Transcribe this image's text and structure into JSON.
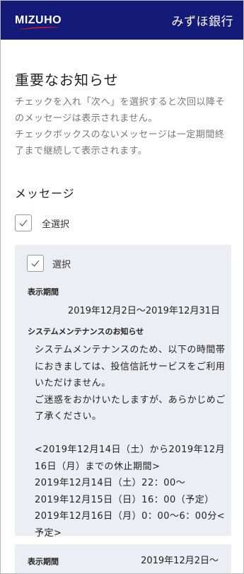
{
  "header": {
    "logo": "MIZUHO",
    "bank_name": "みずほ銀行"
  },
  "page": {
    "title": "重要なお知らせ",
    "intro_1": "チェックを入れ「次へ」を選択すると次回以降そのメッセージは表示されません。",
    "intro_2": "チェックボックスのないメッセージは一定期間終了まで継続して表示されます。"
  },
  "messages_section": {
    "title": "メッセージ",
    "select_all_label": "全選択",
    "select_all_checked": true
  },
  "cards": [
    {
      "select_label": "選択",
      "checked": true,
      "period_label": "表示期間",
      "period_value": "2019年12月2日〜2019年12月31日",
      "message_title": "システムメンテナンスのお知らせ",
      "message_body": "システムメンテナンスのため、以下の時間帯におきましては、投信信託サービスをご利用いただけません。\nご迷惑をおかけいたしますが、あらかじめご了承ください。\n\n<2019年12月14日（土）から2019年12月16日（月）までの休止期間>\n2019年12月14日（土）22：00〜\n2019年12月15日（日）16：00（予定）\n2019年12月16日（月）0：00〜6：00分<予定>"
    },
    {
      "period_label": "表示期間",
      "period_value": "2019年12月2日〜"
    }
  ],
  "colors": {
    "header_bg": "#131a78",
    "card_bg": "#eceef4",
    "logo_accent": "#d7192c"
  }
}
